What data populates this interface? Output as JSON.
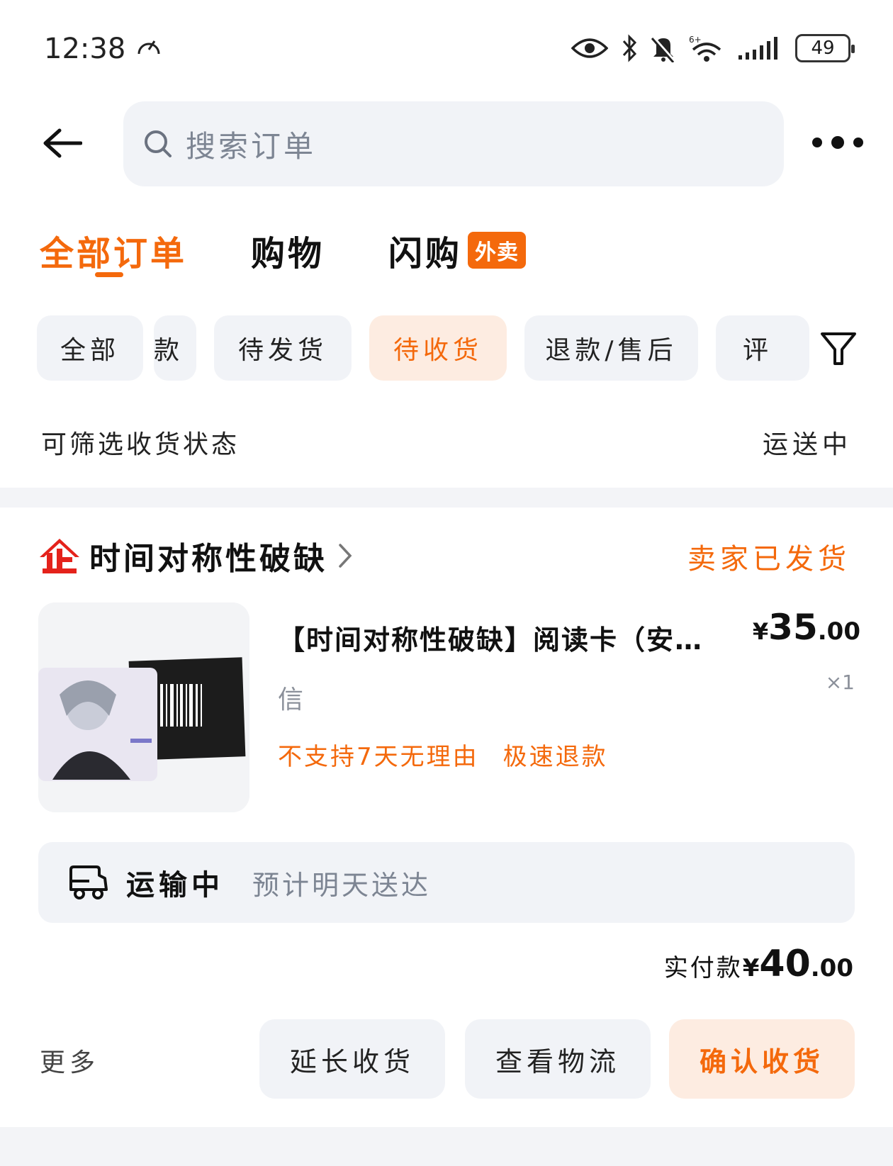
{
  "status_bar": {
    "time": "12:38",
    "battery": "49",
    "icons": [
      "location-sync-icon",
      "eye-icon",
      "bluetooth-icon",
      "mute-icon",
      "wifi-icon",
      "signal-icon",
      "battery-icon"
    ]
  },
  "header": {
    "search_placeholder": "搜索订单"
  },
  "main_tabs": [
    {
      "label": "全部订单"
    },
    {
      "label": "购物"
    },
    {
      "label": "闪购",
      "badge": "外卖"
    }
  ],
  "chips": [
    {
      "label": "全部"
    },
    {
      "label": "款"
    },
    {
      "label": "待发货"
    },
    {
      "label": "待收货"
    },
    {
      "label": "退款/售后"
    },
    {
      "label": "评"
    }
  ],
  "sub_filter": {
    "label": "可筛选收货状态",
    "value": "运送中"
  },
  "order": {
    "shop_name": "时间对称性破缺",
    "status": "卖家已发货",
    "product_title": "【时间对称性破缺】阅读卡（安…",
    "price_currency": "¥",
    "price_int": "35",
    "price_dec": ".00",
    "spec": "信",
    "qty": "×1",
    "tags": [
      "不支持7天无理由",
      "极速退款"
    ],
    "logistics_status": "运输中",
    "logistics_eta": "预计明天送达",
    "paid_label": "实付款",
    "paid_currency": "¥",
    "paid_int": "40",
    "paid_dec": ".00",
    "more": "更多",
    "actions": [
      "延长收货",
      "查看物流",
      "确认收货"
    ]
  },
  "colors": {
    "accent": "#f4690c",
    "accent_bg": "#fdece1",
    "chip_bg": "#f1f3f7",
    "brand_red": "#e4221b"
  }
}
